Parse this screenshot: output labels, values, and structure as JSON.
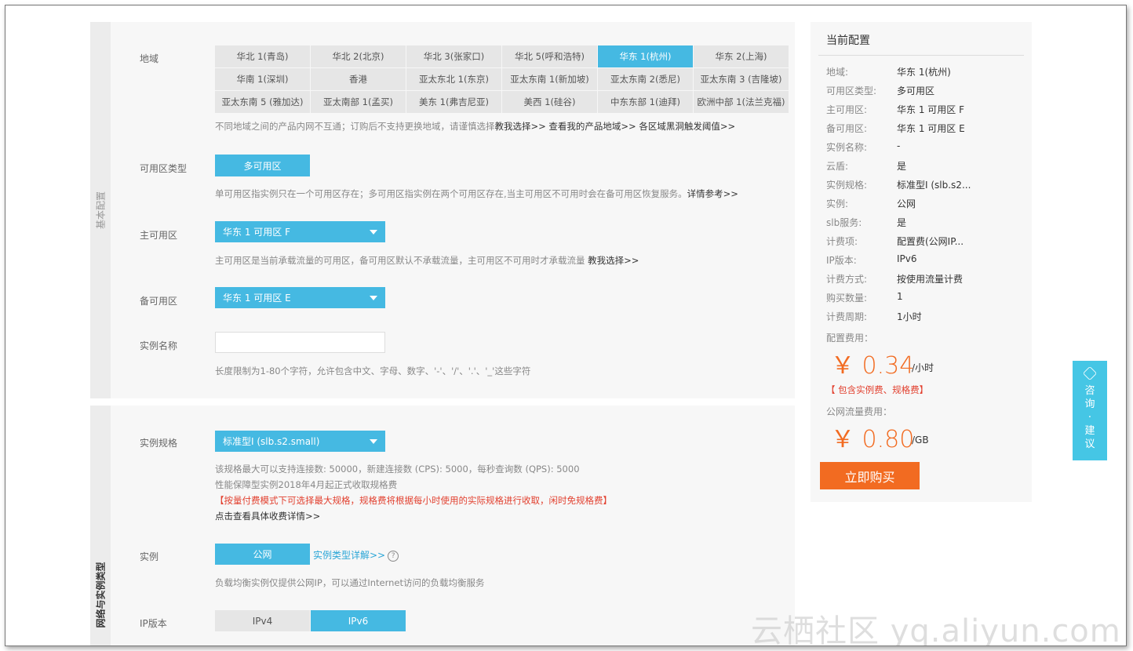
{
  "basic_section": {
    "label": "基本配置",
    "region": {
      "label": "地域",
      "options": [
        "华北 1(青岛)",
        "华北 2(北京)",
        "华北 3(张家口)",
        "华北 5(呼和浩特)",
        "华东 1(杭州)",
        "华东 2(上海)",
        "华南 1(深圳)",
        "香港",
        "亚太东北 1(东京)",
        "亚太东南 1(新加坡)",
        "亚太东南 2(悉尼)",
        "亚太东南 3 (吉隆坡)",
        "亚太东南 5 (雅加达)",
        "亚太南部 1(孟买)",
        "美东 1(弗吉尼亚)",
        "美西 1(硅谷)",
        "中东东部 1(迪拜)",
        "欧洲中部 1(法兰克福)"
      ],
      "selected": "华东 1(杭州)",
      "hint": "不同地域之间的产品内网不互通；订购后不支持更换地域，请谨慎选择",
      "hint_links": "教我选择>> 查看我的产品地域>> 各区域黑洞触发阈值>>"
    },
    "zone_type": {
      "label": "可用区类型",
      "value": "多可用区",
      "hint": "单可用区指实例只在一个可用区存在；多可用区指实例在两个可用区存在,当主可用区不可用时会在备可用区恢复服务。",
      "hint_link": "详情参考>>"
    },
    "primary_zone": {
      "label": "主可用区",
      "value": "华东 1 可用区 F",
      "hint": "主可用区是当前承载流量的可用区，备可用区默认不承载流量，主可用区不可用时才承载流量",
      "hint_link": "教我选择>>"
    },
    "backup_zone": {
      "label": "备可用区",
      "value": "华东 1 可用区 E"
    },
    "instance_name": {
      "label": "实例名称",
      "value": "",
      "hint": "长度限制为1-80个字符，允许包含中文、字母、数字、'-'、'/'、'.'、'_'这些字符"
    }
  },
  "network_section": {
    "label": "网络与实例类型",
    "spec": {
      "label": "实例规格",
      "value": "标准型I (slb.s2.small)",
      "hint1": "该规格最大可以支持连接数: 50000，新建连接数 (CPS): 5000，每秒查询数 (QPS): 5000",
      "hint2": "性能保障型实例2018年4月起正式收取规格费",
      "hint3": "【按量付费模式下可选择最大规格，规格费将根据每小时使用的实际规格进行收取，闲时免规格费】",
      "hint4": "点击查看具体收费详情>>"
    },
    "instance": {
      "label": "实例",
      "value": "公网",
      "link": "实例类型详解>>",
      "help_icon": "?",
      "hint": "负载均衡实例仅提供公网IP，可以通过Internet访问的负载均衡服务"
    },
    "ip_version": {
      "label": "IP版本",
      "options": [
        "IPv4",
        "IPv6"
      ],
      "selected": "IPv6"
    }
  },
  "summary": {
    "title": "当前配置",
    "rows": [
      {
        "k": "地域:",
        "v": "华东 1(杭州)"
      },
      {
        "k": "可用区类型:",
        "v": "多可用区"
      },
      {
        "k": "主可用区:",
        "v": "华东 1 可用区 F"
      },
      {
        "k": "备可用区:",
        "v": "华东 1 可用区 E"
      },
      {
        "k": "实例名称:",
        "v": "-"
      },
      {
        "k": "云盾:",
        "v": "是"
      },
      {
        "k": "实例规格:",
        "v": "标准型I (slb.s2..."
      },
      {
        "k": "实例:",
        "v": "公网"
      },
      {
        "k": "slb服务:",
        "v": "是"
      },
      {
        "k": "计费项:",
        "v": "配置费(公网IP..."
      },
      {
        "k": "IP版本:",
        "v": "IPv6"
      },
      {
        "k": "计费方式:",
        "v": "按使用流量计费"
      },
      {
        "k": "购买数量:",
        "v": "1"
      },
      {
        "k": "计费周期:",
        "v": "1小时"
      }
    ],
    "config_fee_label": "配置费用：",
    "config_fee": "￥ 0.34",
    "config_fee_unit": "/小时",
    "config_note": "【 包含实例费、规格费】",
    "traffic_fee_label": "公网流量费用：",
    "traffic_fee": "￥ 0.80",
    "traffic_fee_unit": "/GB",
    "buy_label": "立即购买"
  },
  "consult": {
    "label": "咨询·建议",
    "icon": "hexagon-chat-icon"
  },
  "watermark": "云栖社区 yq.aliyun.com",
  "colors": {
    "accent": "#45b9e2",
    "price": "#f26b21",
    "warning": "#e2402f",
    "panel": "#f7f7f7"
  }
}
